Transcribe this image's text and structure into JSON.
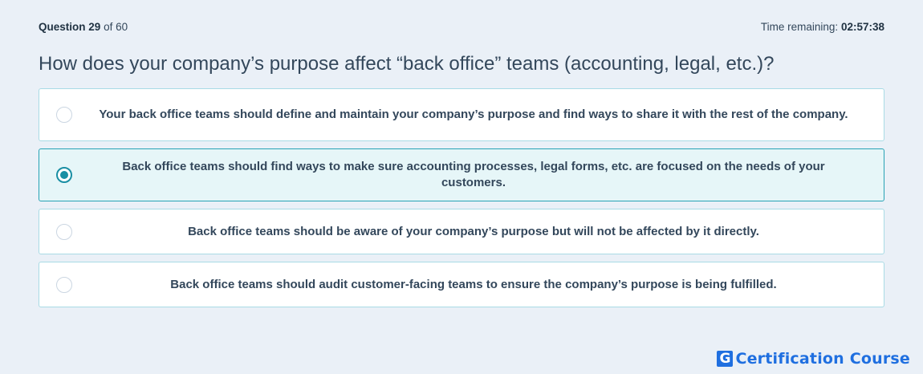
{
  "header": {
    "question_label": "Question",
    "question_number": "29",
    "of_label": "of 60",
    "time_label": "Time remaining:",
    "time_value": "02:57:38"
  },
  "question": {
    "title": "How does your company’s purpose affect “back office” teams (accounting, legal, etc.)?"
  },
  "options": [
    {
      "text": "Your back office teams should define and maintain your company’s purpose and find ways to share it with the rest of the company.",
      "selected": false
    },
    {
      "text": "Back office teams should find ways to make sure accounting processes, legal forms, etc. are focused on the needs of your customers.",
      "selected": true
    },
    {
      "text": "Back office teams should be aware of your company’s purpose but will not be affected by it directly.",
      "selected": false
    },
    {
      "text": "Back office teams should audit customer-facing teams to ensure the company’s purpose is being fulfilled.",
      "selected": false
    }
  ],
  "brand": {
    "logo_letter": "G",
    "name": "Certification Course",
    "color": "#1f6fe0"
  },
  "colors": {
    "background": "#eaf0f7",
    "selected_accent": "#1a8fa4",
    "option_border": "#a9dbe5"
  }
}
